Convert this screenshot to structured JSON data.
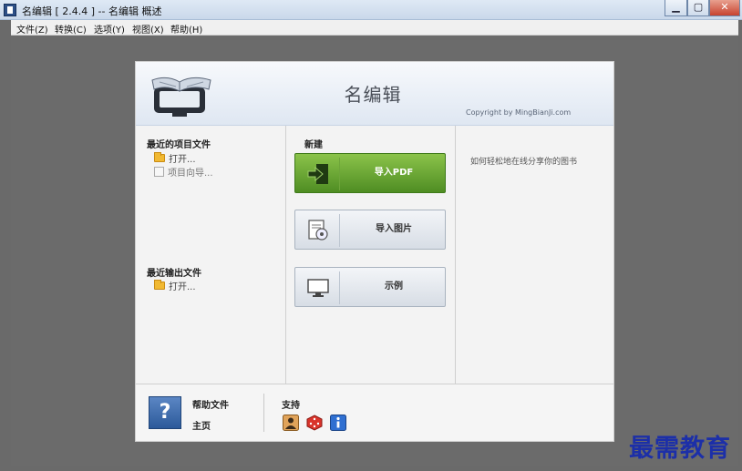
{
  "window": {
    "title": "名编辑 [ 2.4.4 ] -- 名编辑 概述",
    "min_label": "▁",
    "max_label": "▢",
    "close_label": "✕"
  },
  "menu": [
    "文件(Z)",
    "转换(C)",
    "选项(Y)",
    "视图(X)",
    "帮助(H)"
  ],
  "header": {
    "brand": "名编辑",
    "copyright": "Copyright by MingBianJi.com"
  },
  "recent_projects": {
    "title": "最近的项目文件",
    "open_label": "打开...",
    "wizard_label": "项目向导..."
  },
  "recent_outputs": {
    "title": "最近输出文件",
    "open_label": "打开..."
  },
  "new_section": {
    "title": "新建",
    "import_pdf": "导入PDF",
    "import_images": "导入图片",
    "example": "示例"
  },
  "tip": "如何轻松地在线分享你的图书",
  "footer": {
    "help_symbol": "?",
    "help_title": "帮助文件",
    "home": "主页",
    "support": "支持"
  },
  "watermark": "最需教育",
  "colors": {
    "accent_green": "#5a9a2c",
    "help_blue": "#2c5a9a",
    "watermark": "#1c2fa8"
  }
}
